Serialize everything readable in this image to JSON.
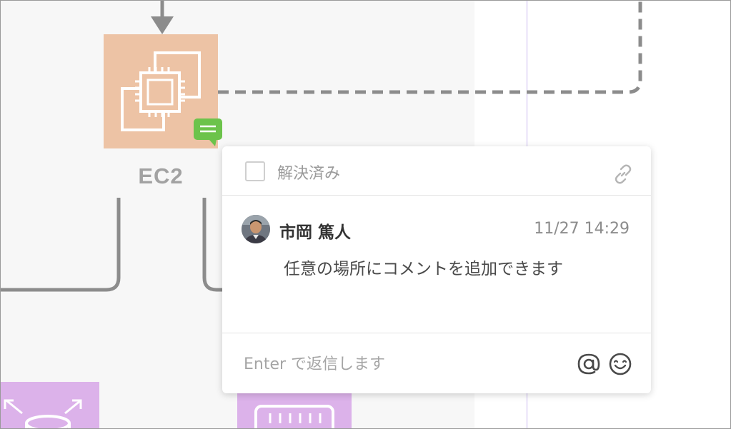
{
  "diagram": {
    "ec2_label": "EC2",
    "nodes": [
      {
        "name": "ec2-node",
        "icon": "ec2-instances-icon"
      },
      {
        "name": "load-balancer-node",
        "icon": "network-arrows-icon"
      },
      {
        "name": "gateway-node",
        "icon": "gateway-icon"
      }
    ],
    "comment_badge_icon": "comment-icon"
  },
  "comment_panel": {
    "resolved_label": "解決済み",
    "resolved_checked": false,
    "link_icon": "link-icon",
    "comment": {
      "author": "市岡 篤人",
      "timestamp": "11/27 14:29",
      "body": "任意の場所にコメントを追加できます"
    },
    "reply": {
      "placeholder": "Enter で返信します",
      "value": "",
      "mention_icon": "at-icon",
      "emoji_icon": "emoji-icon"
    }
  },
  "colors": {
    "ec2": "#edc3a5",
    "purple_node": "#dcb2ea",
    "badge": "#6cc34b",
    "connector": "#8c8c8c",
    "guide": "#c9b8f0"
  }
}
